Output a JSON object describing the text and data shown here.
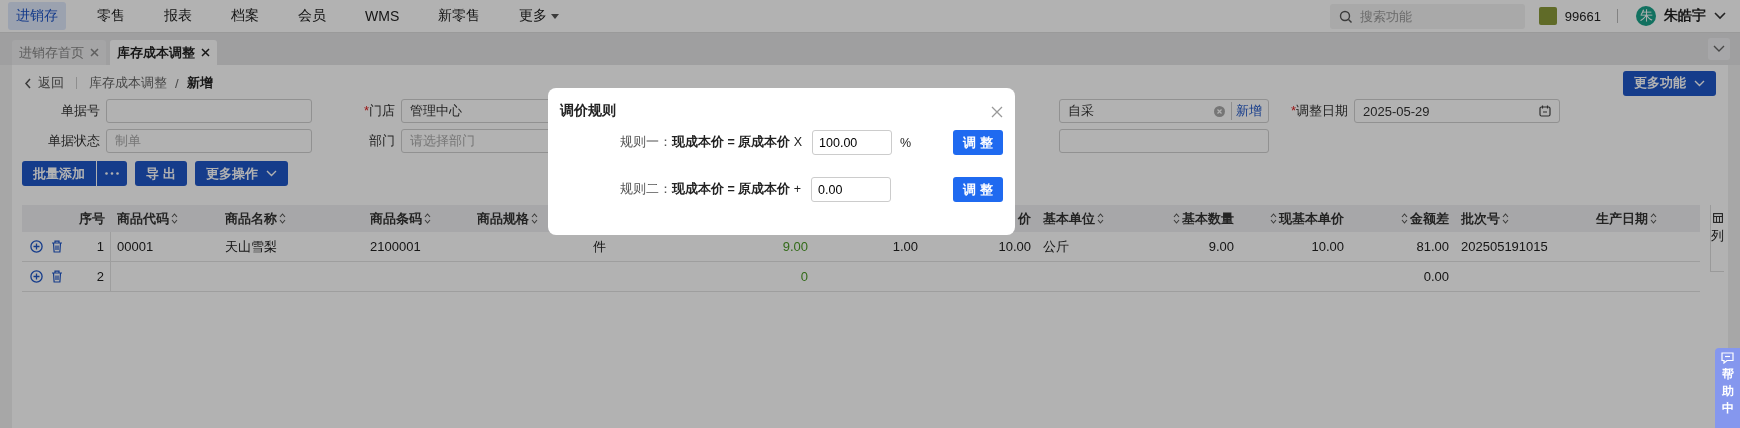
{
  "top_nav": {
    "items": [
      {
        "label": "进销存",
        "selected": true
      },
      {
        "label": "零售",
        "selected": false
      },
      {
        "label": "报表",
        "selected": false
      },
      {
        "label": "档案",
        "selected": false
      },
      {
        "label": "会员",
        "selected": false
      },
      {
        "label": "WMS",
        "selected": false
      },
      {
        "label": "新零售",
        "selected": false
      },
      {
        "label": "更多",
        "selected": false,
        "kind": "dropdown"
      }
    ],
    "search": {
      "placeholder": "搜索功能"
    },
    "account": "99661",
    "user": {
      "initial": "朱",
      "name": "朱皓宇"
    }
  },
  "tabs": [
    {
      "label": "进销存首页",
      "selected": false
    },
    {
      "label": "库存成本调整",
      "selected": true
    }
  ],
  "breadcrumb": {
    "back": "返回",
    "path": "库存成本调整",
    "separator": "/",
    "current": "新增"
  },
  "more_functions": "更多功能",
  "form": {
    "row_1": [
      {
        "label": "单据号"
      },
      {
        "label": "门店",
        "required_mark": "*",
        "value": "管理中心"
      },
      {
        "value": "自采",
        "kind": "clearable",
        "action": "新增"
      },
      {
        "label": "调整日期",
        "required_mark": "*",
        "value": "2025-05-29",
        "kind": "date"
      }
    ],
    "row_2": [
      {
        "label": "单据状态",
        "placeholder": "制单"
      },
      {
        "label": "部门",
        "placeholder": "请选择部门"
      },
      {
        "kind": "text"
      }
    ]
  },
  "toolbar": {
    "batch_add": "批量添加",
    "export": "导 出",
    "more_actions": "更多操作"
  },
  "table": {
    "columns": [
      {
        "label": "序号",
        "sortable": false
      },
      {
        "label": "商品代码",
        "sortable": true
      },
      {
        "label": "商品名称",
        "sortable": true
      },
      {
        "label": "商品条码",
        "sortable": true
      },
      {
        "label": "商品规格",
        "sortable": true
      },
      {},
      {
        "emphasis": true
      },
      {},
      {
        "label": "价",
        "sortable": false
      },
      {
        "label": "基本单位",
        "sortable": true
      },
      {
        "label": "基本数量",
        "sortable": true
      },
      {
        "label": "现基本单价",
        "sortable": true
      },
      {
        "label": "金额差",
        "sortable": true
      },
      {
        "label": "批次号",
        "sortable": true
      },
      {
        "label": "生产日期",
        "sortable": true
      }
    ],
    "rows": [
      {
        "cells": [
          "1",
          "00001",
          "天山雪梨",
          "2100001",
          null,
          "件",
          "9.00",
          "1.00",
          "10.00",
          "公斤",
          "9.00",
          "10.00",
          "81.00",
          "202505191015",
          null
        ]
      },
      {
        "cells": [
          "2",
          null,
          null,
          null,
          null,
          null,
          "0",
          null,
          null,
          null,
          null,
          null,
          "0.00",
          null,
          null
        ]
      }
    ],
    "column_button": "列"
  },
  "help_tab": "帮助中",
  "dialog": {
    "title": "调价规则",
    "rules": [
      {
        "label": "规则一：",
        "formula": "**现成本价 = 原成本价** X",
        "value": "100.00",
        "unit": "%",
        "button": "调 整"
      },
      {
        "label": "规则二：",
        "formula": "**现成本价 = 原成本价** +",
        "value": "0.00",
        "button": "调 整"
      }
    ]
  }
}
